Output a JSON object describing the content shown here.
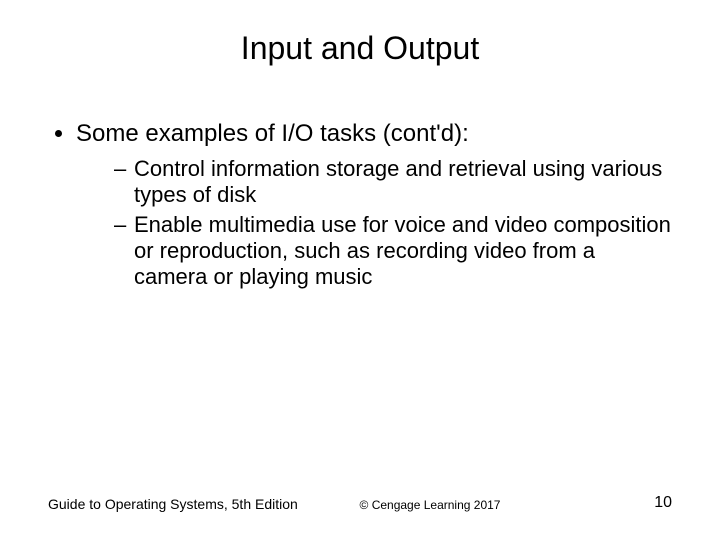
{
  "slide": {
    "title": "Input and Output",
    "bullet_main": "Some examples of I/O tasks (cont'd):",
    "sub_bullets": [
      "Control information storage and retrieval using various types of disk",
      "Enable multimedia use for voice and video composition or reproduction, such as recording video from a camera or playing music"
    ],
    "footer_left": "Guide to Operating Systems, 5th Edition",
    "footer_center": "© Cengage Learning  2017",
    "page_number": "10"
  }
}
